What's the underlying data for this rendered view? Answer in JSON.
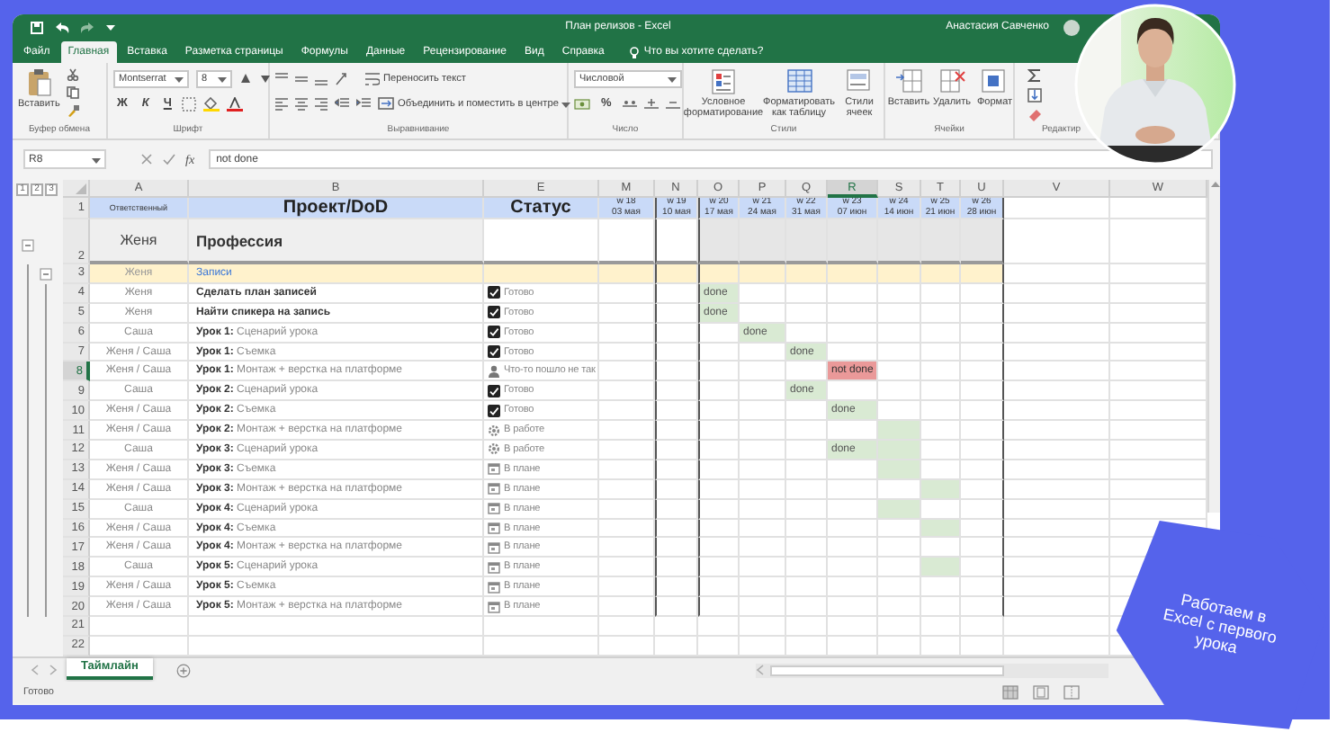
{
  "window": {
    "title": "План релизов - Excel",
    "user": "Анастасия Савченко"
  },
  "tabs": [
    {
      "label": "Файл",
      "selected": false
    },
    {
      "label": "Главная",
      "selected": true
    },
    {
      "label": "Вставка",
      "selected": false
    },
    {
      "label": "Разметка страницы",
      "selected": false
    },
    {
      "label": "Формулы",
      "selected": false
    },
    {
      "label": "Данные",
      "selected": false
    },
    {
      "label": "Рецензирование",
      "selected": false
    },
    {
      "label": "Вид",
      "selected": false
    },
    {
      "label": "Справка",
      "selected": false
    }
  ],
  "tell_me": "Что вы хотите сделать?",
  "ribbon": {
    "groups": [
      {
        "kind": "clipboard",
        "label": "Буфер обмена",
        "paste": "Вставить"
      },
      {
        "kind": "font",
        "label": "Шрифт",
        "font": "Montserrat",
        "size": "8",
        "bold": "Ж",
        "italic": "К",
        "underline": "Ч"
      },
      {
        "kind": "alignment",
        "label": "Выравнивание",
        "wrap": "Переносить текст",
        "merge": "Объединить и поместить в центре"
      },
      {
        "kind": "number",
        "label": "Число",
        "format": "Числовой",
        "percent": "%"
      },
      {
        "kind": "styles",
        "label": "Стили",
        "buttons": [
          "Условное форматирование",
          "Форматировать как таблицу",
          "Стили ячеек"
        ]
      },
      {
        "kind": "cells",
        "label": "Ячейки",
        "buttons": [
          "Вставить",
          "Удалить",
          "Формат"
        ]
      },
      {
        "kind": "editing",
        "label": "Редактир"
      }
    ]
  },
  "formula_bar": {
    "name_box": "R8",
    "function_label": "fx",
    "value": "not done"
  },
  "outline_levels": [
    "1",
    "2",
    "3"
  ],
  "columns": [
    {
      "letter": "A",
      "selected": false
    },
    {
      "letter": "B",
      "selected": false
    },
    {
      "letter": "E",
      "selected": false
    },
    {
      "letter": "M",
      "selected": false
    },
    {
      "letter": "N",
      "selected": false
    },
    {
      "letter": "O",
      "selected": false
    },
    {
      "letter": "P",
      "selected": false
    },
    {
      "letter": "Q",
      "selected": false
    },
    {
      "letter": "R",
      "selected": true
    },
    {
      "letter": "S",
      "selected": false
    },
    {
      "letter": "T",
      "selected": false
    },
    {
      "letter": "U",
      "selected": false
    },
    {
      "letter": "V",
      "selected": false
    },
    {
      "letter": "W",
      "selected": false
    }
  ],
  "header_row": {
    "number": "1",
    "owner": "Ответственный",
    "project": "Проект/DoD",
    "status": "Статус",
    "weeks": [
      {
        "week": "w 18",
        "date": "03 мая"
      },
      {
        "week": "w 19",
        "date": "10 мая"
      },
      {
        "week": "w 20",
        "date": "17 мая"
      },
      {
        "week": "w 21",
        "date": "24 мая"
      },
      {
        "week": "w 22",
        "date": "31 мая"
      },
      {
        "week": "w 23",
        "date": "07 июн"
      },
      {
        "week": "w 24",
        "date": "14 июн"
      },
      {
        "week": "w 25",
        "date": "21 июн"
      },
      {
        "week": "w 26",
        "date": "28 июн"
      }
    ]
  },
  "group_row": {
    "number": "2",
    "owner": "Женя",
    "project": "Профессия"
  },
  "rows": [
    {
      "number": "3",
      "kind": "section",
      "selected": false,
      "owner": "Женя",
      "task": "Записи"
    },
    {
      "number": "4",
      "kind": "task",
      "selected": false,
      "owner": "Женя",
      "task": "Сделать план записей",
      "bold": true,
      "status": {
        "kind": "done",
        "label": "Готово"
      },
      "timeline": [
        {
          "kind": "empty"
        },
        {
          "kind": "empty"
        },
        {
          "kind": "done",
          "text": "done"
        },
        {
          "kind": "empty"
        },
        {
          "kind": "empty"
        },
        {
          "kind": "empty"
        },
        {
          "kind": "empty"
        },
        {
          "kind": "empty"
        },
        {
          "kind": "empty"
        }
      ]
    },
    {
      "number": "5",
      "kind": "task",
      "selected": false,
      "owner": "Женя",
      "task": "Найти спикера на запись",
      "bold": true,
      "status": {
        "kind": "done",
        "label": "Готово"
      },
      "timeline": [
        {
          "kind": "empty"
        },
        {
          "kind": "empty"
        },
        {
          "kind": "done",
          "text": "done"
        },
        {
          "kind": "empty"
        },
        {
          "kind": "empty"
        },
        {
          "kind": "empty"
        },
        {
          "kind": "empty"
        },
        {
          "kind": "empty"
        },
        {
          "kind": "empty"
        }
      ]
    },
    {
      "number": "6",
      "kind": "task",
      "selected": false,
      "owner": "Саша",
      "task": "**Урок 1:** Сценарий урока",
      "bold": false,
      "status": {
        "kind": "done",
        "label": "Готово"
      },
      "timeline": [
        {
          "kind": "empty"
        },
        {
          "kind": "empty"
        },
        {
          "kind": "empty"
        },
        {
          "kind": "done",
          "text": "done"
        },
        {
          "kind": "empty"
        },
        {
          "kind": "empty"
        },
        {
          "kind": "empty"
        },
        {
          "kind": "empty"
        },
        {
          "kind": "empty"
        }
      ]
    },
    {
      "number": "7",
      "kind": "task",
      "selected": false,
      "owner": "Женя / Саша",
      "task": "**Урок 1:** Съемка",
      "bold": false,
      "status": {
        "kind": "done",
        "label": "Готово"
      },
      "timeline": [
        {
          "kind": "empty"
        },
        {
          "kind": "empty"
        },
        {
          "kind": "empty"
        },
        {
          "kind": "empty"
        },
        {
          "kind": "done",
          "text": "done"
        },
        {
          "kind": "empty"
        },
        {
          "kind": "empty"
        },
        {
          "kind": "empty"
        },
        {
          "kind": "empty"
        }
      ]
    },
    {
      "number": "8",
      "kind": "task",
      "selected": true,
      "owner": "Женя / Саша",
      "task": "**Урок 1:** Монтаж + верстка на платформе",
      "bold": false,
      "status": {
        "kind": "problem",
        "label": "Что-то пошло не так"
      },
      "timeline": [
        {
          "kind": "empty"
        },
        {
          "kind": "empty"
        },
        {
          "kind": "empty"
        },
        {
          "kind": "empty"
        },
        {
          "kind": "empty"
        },
        {
          "kind": "failed",
          "text": "not done"
        },
        {
          "kind": "empty"
        },
        {
          "kind": "empty"
        },
        {
          "kind": "empty"
        }
      ]
    },
    {
      "number": "9",
      "kind": "task",
      "selected": false,
      "owner": "Саша",
      "task": "**Урок 2:** Сценарий урока",
      "bold": false,
      "status": {
        "kind": "done",
        "label": "Готово"
      },
      "timeline": [
        {
          "kind": "empty"
        },
        {
          "kind": "empty"
        },
        {
          "kind": "empty"
        },
        {
          "kind": "empty"
        },
        {
          "kind": "done",
          "text": "done"
        },
        {
          "kind": "empty"
        },
        {
          "kind": "empty"
        },
        {
          "kind": "empty"
        },
        {
          "kind": "empty"
        }
      ]
    },
    {
      "number": "10",
      "kind": "task",
      "selected": false,
      "owner": "Женя / Саша",
      "task": "**Урок 2:** Съемка",
      "bold": false,
      "status": {
        "kind": "done",
        "label": "Готово"
      },
      "timeline": [
        {
          "kind": "empty"
        },
        {
          "kind": "empty"
        },
        {
          "kind": "empty"
        },
        {
          "kind": "empty"
        },
        {
          "kind": "empty"
        },
        {
          "kind": "done",
          "text": "done"
        },
        {
          "kind": "empty"
        },
        {
          "kind": "empty"
        },
        {
          "kind": "empty"
        }
      ]
    },
    {
      "number": "11",
      "kind": "task",
      "selected": false,
      "owner": "Женя / Саша",
      "task": "**Урок 2:** Монтаж + верстка на платформе",
      "bold": false,
      "status": {
        "kind": "progress",
        "label": "В работе"
      },
      "timeline": [
        {
          "kind": "empty"
        },
        {
          "kind": "empty"
        },
        {
          "kind": "empty"
        },
        {
          "kind": "empty"
        },
        {
          "kind": "empty"
        },
        {
          "kind": "empty"
        },
        {
          "kind": "planned"
        },
        {
          "kind": "empty"
        },
        {
          "kind": "empty"
        }
      ]
    },
    {
      "number": "12",
      "kind": "task",
      "selected": false,
      "owner": "Саша",
      "task": "**Урок 3:** Сценарий урока",
      "bold": false,
      "status": {
        "kind": "progress",
        "label": "В работе"
      },
      "timeline": [
        {
          "kind": "empty"
        },
        {
          "kind": "empty"
        },
        {
          "kind": "empty"
        },
        {
          "kind": "empty"
        },
        {
          "kind": "empty"
        },
        {
          "kind": "done",
          "text": "done"
        },
        {
          "kind": "planned"
        },
        {
          "kind": "empty"
        },
        {
          "kind": "empty"
        }
      ]
    },
    {
      "number": "13",
      "kind": "task",
      "selected": false,
      "owner": "Женя / Саша",
      "task": "**Урок 3:** Съемка",
      "bold": false,
      "status": {
        "kind": "plan",
        "label": "В плане"
      },
      "timeline": [
        {
          "kind": "empty"
        },
        {
          "kind": "empty"
        },
        {
          "kind": "empty"
        },
        {
          "kind": "empty"
        },
        {
          "kind": "empty"
        },
        {
          "kind": "empty"
        },
        {
          "kind": "planned"
        },
        {
          "kind": "empty"
        },
        {
          "kind": "empty"
        }
      ]
    },
    {
      "number": "14",
      "kind": "task",
      "selected": false,
      "owner": "Женя / Саша",
      "task": "**Урок 3:** Монтаж + верстка на платформе",
      "bold": false,
      "status": {
        "kind": "plan",
        "label": "В плане"
      },
      "timeline": [
        {
          "kind": "empty"
        },
        {
          "kind": "empty"
        },
        {
          "kind": "empty"
        },
        {
          "kind": "empty"
        },
        {
          "kind": "empty"
        },
        {
          "kind": "empty"
        },
        {
          "kind": "empty"
        },
        {
          "kind": "planned"
        },
        {
          "kind": "empty"
        }
      ]
    },
    {
      "number": "15",
      "kind": "task",
      "selected": false,
      "owner": "Саша",
      "task": "**Урок 4:** Сценарий урока",
      "bold": false,
      "status": {
        "kind": "plan",
        "label": "В плане"
      },
      "timeline": [
        {
          "kind": "empty"
        },
        {
          "kind": "empty"
        },
        {
          "kind": "empty"
        },
        {
          "kind": "empty"
        },
        {
          "kind": "empty"
        },
        {
          "kind": "empty"
        },
        {
          "kind": "planned"
        },
        {
          "kind": "empty"
        },
        {
          "kind": "empty"
        }
      ]
    },
    {
      "number": "16",
      "kind": "task",
      "selected": false,
      "owner": "Женя / Саша",
      "task": "**Урок 4:** Съемка",
      "bold": false,
      "status": {
        "kind": "plan",
        "label": "В плане"
      },
      "timeline": [
        {
          "kind": "empty"
        },
        {
          "kind": "empty"
        },
        {
          "kind": "empty"
        },
        {
          "kind": "empty"
        },
        {
          "kind": "empty"
        },
        {
          "kind": "empty"
        },
        {
          "kind": "empty"
        },
        {
          "kind": "planned"
        },
        {
          "kind": "empty"
        }
      ]
    },
    {
      "number": "17",
      "kind": "task",
      "selected": false,
      "owner": "Женя / Саша",
      "task": "**Урок 4:** Монтаж + верстка на платформе",
      "bold": false,
      "status": {
        "kind": "plan",
        "label": "В плане"
      },
      "timeline": [
        {
          "kind": "empty"
        },
        {
          "kind": "empty"
        },
        {
          "kind": "empty"
        },
        {
          "kind": "empty"
        },
        {
          "kind": "empty"
        },
        {
          "kind": "empty"
        },
        {
          "kind": "empty"
        },
        {
          "kind": "empty"
        },
        {
          "kind": "empty"
        }
      ]
    },
    {
      "number": "18",
      "kind": "task",
      "selected": false,
      "owner": "Саша",
      "task": "**Урок 5:** Сценарий урока",
      "bold": false,
      "status": {
        "kind": "plan",
        "label": "В плане"
      },
      "timeline": [
        {
          "kind": "empty"
        },
        {
          "kind": "empty"
        },
        {
          "kind": "empty"
        },
        {
          "kind": "empty"
        },
        {
          "kind": "empty"
        },
        {
          "kind": "empty"
        },
        {
          "kind": "empty"
        },
        {
          "kind": "planned"
        },
        {
          "kind": "empty"
        }
      ]
    },
    {
      "number": "19",
      "kind": "task",
      "selected": false,
      "owner": "Женя / Саша",
      "task": "**Урок 5:** Съемка",
      "bold": false,
      "status": {
        "kind": "plan",
        "label": "В плане"
      },
      "timeline": [
        {
          "kind": "empty"
        },
        {
          "kind": "empty"
        },
        {
          "kind": "empty"
        },
        {
          "kind": "empty"
        },
        {
          "kind": "empty"
        },
        {
          "kind": "empty"
        },
        {
          "kind": "empty"
        },
        {
          "kind": "empty"
        },
        {
          "kind": "empty"
        }
      ]
    },
    {
      "number": "20",
      "kind": "task",
      "selected": false,
      "owner": "Женя / Саша",
      "task": "**Урок 5:** Монтаж + верстка на платформе",
      "bold": false,
      "status": {
        "kind": "plan",
        "label": "В плане"
      },
      "timeline": [
        {
          "kind": "empty"
        },
        {
          "kind": "empty"
        },
        {
          "kind": "empty"
        },
        {
          "kind": "empty"
        },
        {
          "kind": "empty"
        },
        {
          "kind": "empty"
        },
        {
          "kind": "empty"
        },
        {
          "kind": "empty"
        },
        {
          "kind": "empty"
        }
      ]
    },
    {
      "number": "21",
      "kind": "empty",
      "selected": false
    },
    {
      "number": "22",
      "kind": "empty",
      "selected": false
    }
  ],
  "sheet_tabs": [
    {
      "label": "Таймлайн",
      "selected": true
    }
  ],
  "status_bar": {
    "text": "Готово"
  },
  "badge": "Работаем в Excel с первого урока"
}
